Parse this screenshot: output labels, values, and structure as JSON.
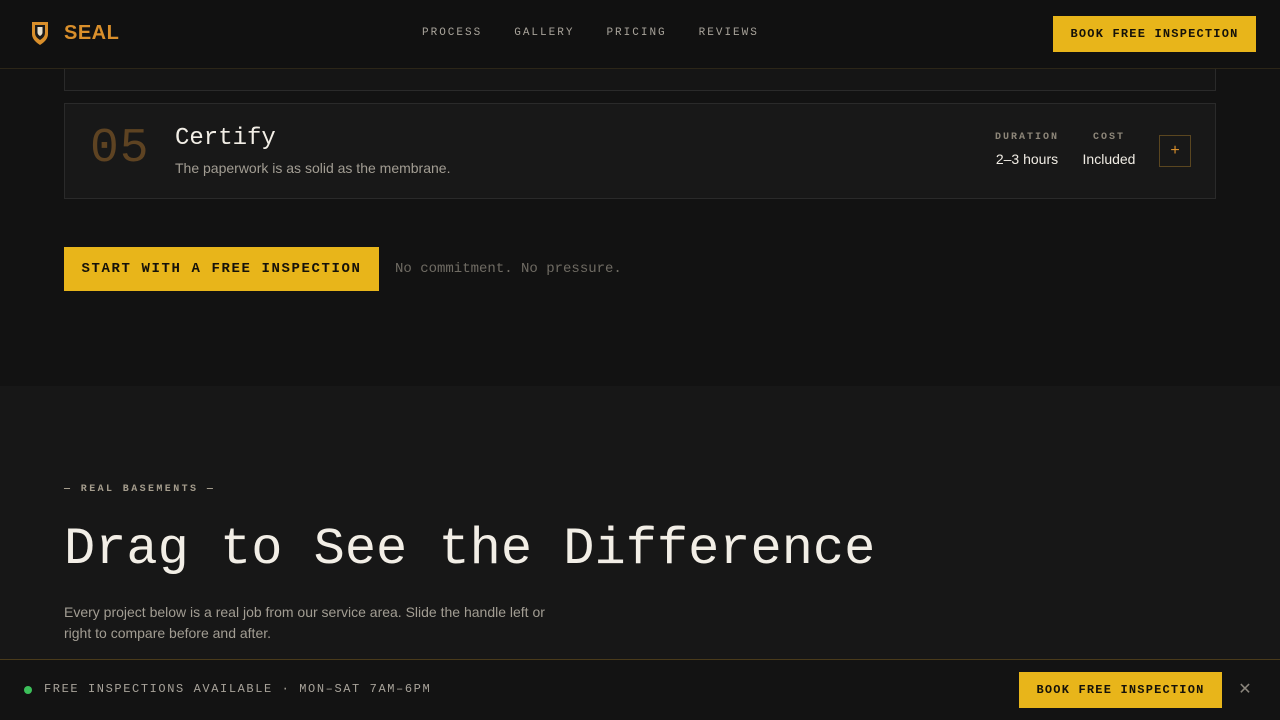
{
  "header": {
    "brand": "SEAL",
    "nav": [
      "PROCESS",
      "GALLERY",
      "PRICING",
      "REVIEWS"
    ],
    "cta": "BOOK FREE INSPECTION"
  },
  "step": {
    "number": "05",
    "title": "Certify",
    "description": "The paperwork is as solid as the membrane.",
    "duration_label": "DURATION",
    "duration_value": "2–3 hours",
    "cost_label": "COST",
    "cost_value": "Included",
    "expand_symbol": "+"
  },
  "cta": {
    "label": "START WITH A FREE INSPECTION",
    "note": "No commitment. No pressure."
  },
  "gallery": {
    "eyebrow": "— REAL BASEMENTS —",
    "heading": "Drag to See the Difference",
    "lead": "Every project below is a real job from our service area. Slide the handle left or right to compare before and after."
  },
  "bottom_bar": {
    "status": "FREE INSPECTIONS AVAILABLE · MON–SAT 7AM–6PM",
    "status_color": "#3cbf5a",
    "cta": "BOOK FREE INSPECTION",
    "close_symbol": "✕"
  },
  "colors": {
    "accent_yellow": "#e8b51a",
    "brand_orange": "#d98f2b",
    "background": "#121212"
  }
}
